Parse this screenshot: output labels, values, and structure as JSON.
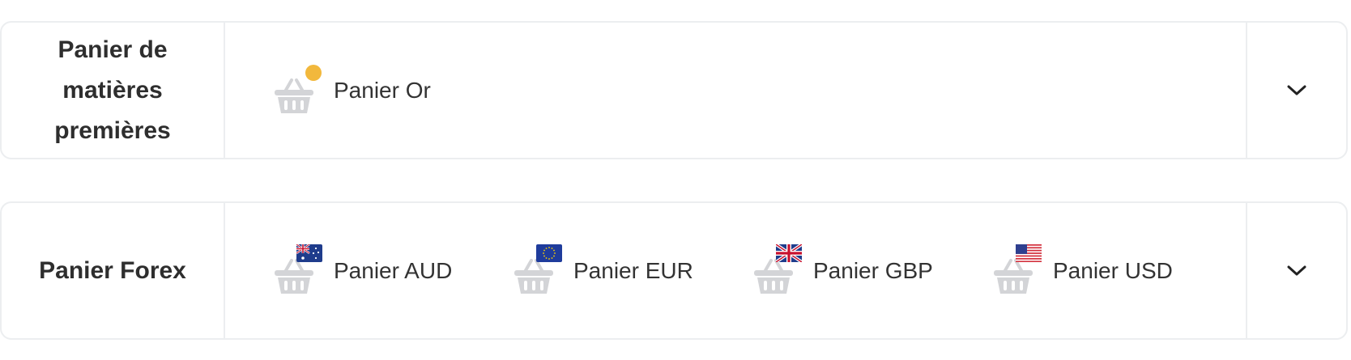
{
  "colors": {
    "border": "#eceef0",
    "basket": "#d3d4d7",
    "gold": "#f2b83c",
    "text": "#333333"
  },
  "sections": [
    {
      "label": "Panier de matières premières",
      "items": [
        {
          "label": "Panier Or",
          "icon": "basket-gold-icon"
        }
      ],
      "toggle_icon": "chevron-down-icon"
    },
    {
      "label": "Panier Forex",
      "items": [
        {
          "label": "Panier AUD",
          "icon": "basket-australia-flag-icon"
        },
        {
          "label": "Panier EUR",
          "icon": "basket-eu-flag-icon"
        },
        {
          "label": "Panier GBP",
          "icon": "basket-uk-flag-icon"
        },
        {
          "label": "Panier USD",
          "icon": "basket-us-flag-icon"
        }
      ],
      "toggle_icon": "chevron-down-icon"
    }
  ]
}
